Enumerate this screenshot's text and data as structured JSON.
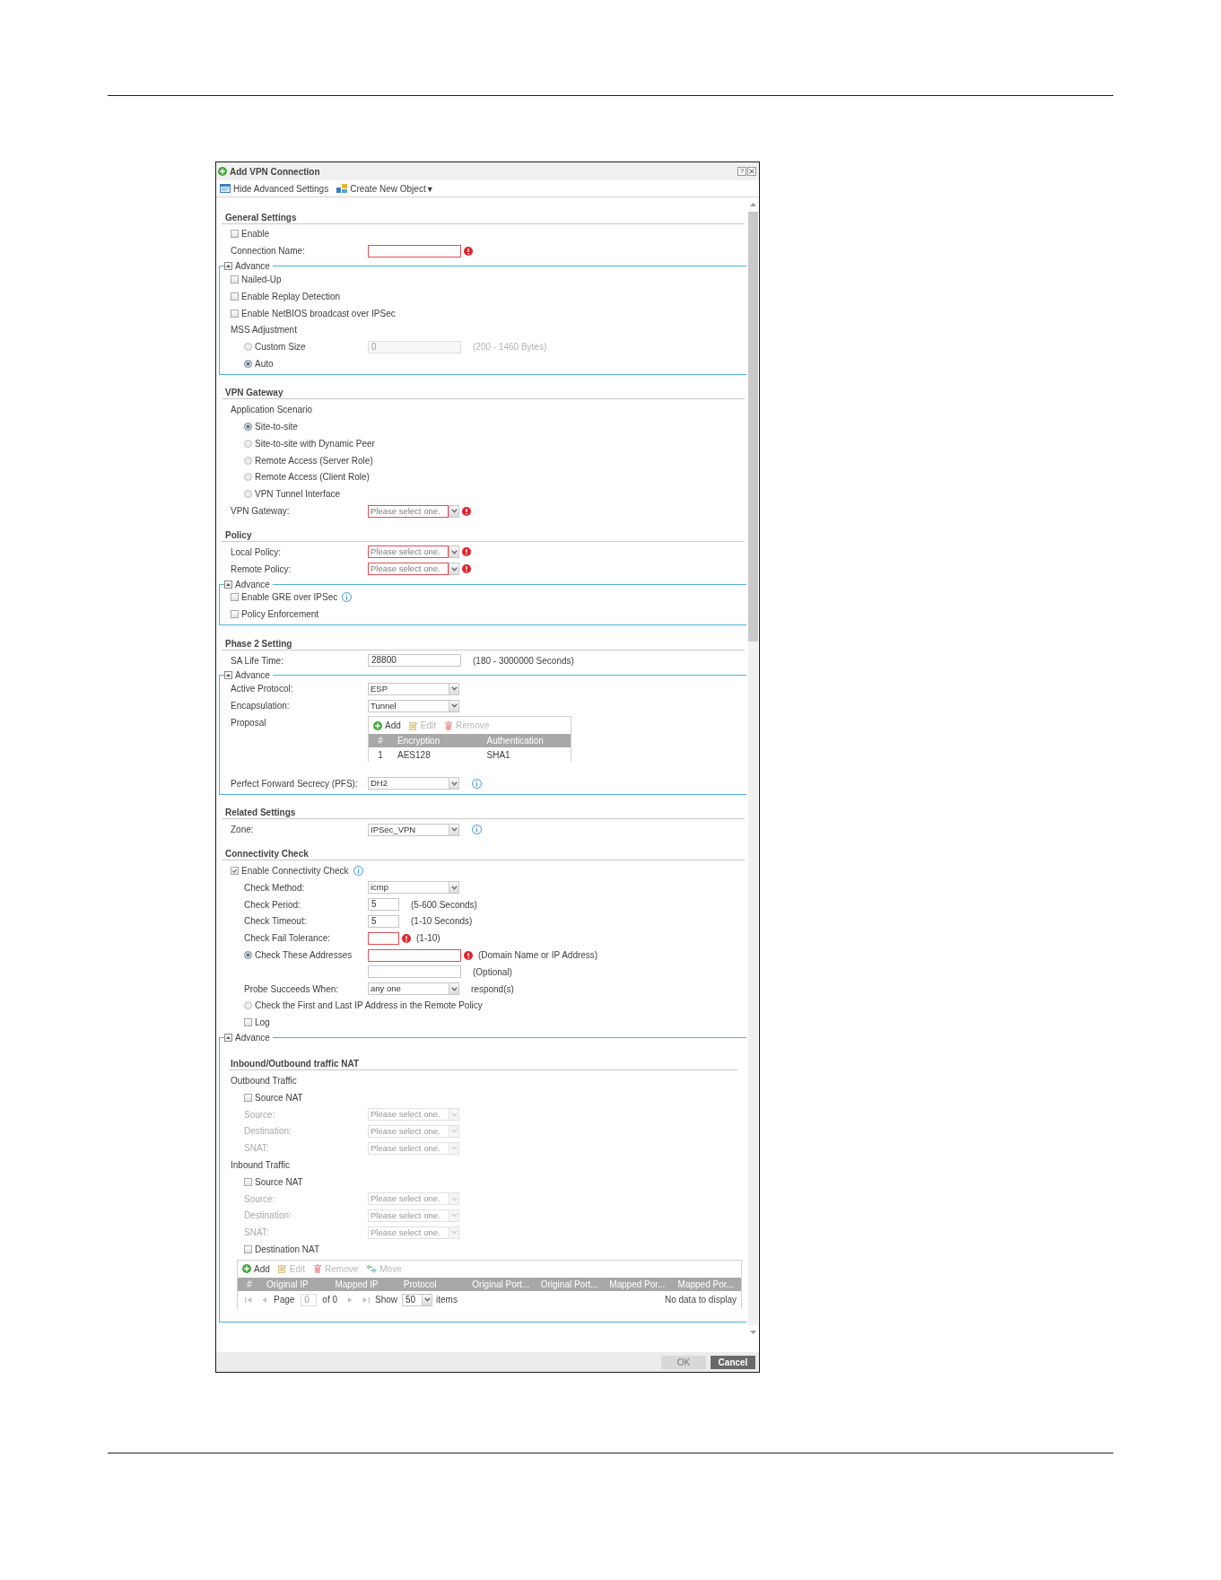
{
  "window": {
    "title": "Add VPN Connection",
    "controls": [
      {
        "kind": "help",
        "glyph": "?"
      },
      {
        "kind": "close"
      }
    ]
  },
  "toolbar": [
    {
      "kind": "toggle",
      "label": "Hide Advanced Settings"
    },
    {
      "kind": "menu",
      "label": "Create New Object",
      "caret": "▼"
    }
  ],
  "sections": [
    {
      "title": "General Settings",
      "rows": [
        {
          "kind": "checkbox",
          "label": "Enable",
          "checked": false
        },
        {
          "kind": "text",
          "label": "Connection Name:",
          "error": true,
          "disabled": false
        }
      ],
      "advance": {
        "label": "Advance",
        "expanded": true,
        "rows": [
          {
            "kind": "checkbox",
            "label": "Nailed-Up",
            "checked": false
          },
          {
            "kind": "checkbox",
            "label": "Enable Replay Detection",
            "checked": false
          },
          {
            "kind": "checkbox",
            "label": "Enable NetBIOS broadcast over IPSec",
            "checked": false
          },
          {
            "kind": "group",
            "label": "MSS Adjustment",
            "children": [
              {
                "kind": "radio",
                "label": "Custom Size",
                "selected": false,
                "input": {
                  "value": "0",
                  "error": false,
                  "disabled": true
                },
                "hint": "(200 - 1460 Bytes)"
              },
              {
                "kind": "radio",
                "label": "Auto",
                "selected": true
              }
            ]
          }
        ]
      }
    },
    {
      "title": "VPN Gateway",
      "rows": [
        {
          "kind": "group",
          "label": "Application Scenario",
          "children": [
            {
              "kind": "radio",
              "label": "Site-to-site",
              "selected": true
            },
            {
              "kind": "radio",
              "label": "Site-to-site with Dynamic Peer",
              "selected": false
            },
            {
              "kind": "radio",
              "label": "Remote Access (Server Role)",
              "selected": false
            },
            {
              "kind": "radio",
              "label": "Remote Access (Client Role)",
              "selected": false
            },
            {
              "kind": "radio",
              "label": "VPN Tunnel Interface",
              "selected": false
            }
          ]
        },
        {
          "kind": "select",
          "label": "VPN Gateway:",
          "placeholder": "Please select one.",
          "error": true,
          "disabled": false
        }
      ]
    },
    {
      "title": "Policy",
      "rows": [
        {
          "kind": "select",
          "label": "Local Policy:",
          "placeholder": "Please select one.",
          "error": true,
          "disabled": false
        },
        {
          "kind": "select",
          "label": "Remote Policy:",
          "placeholder": "Please select one.",
          "error": true,
          "disabled": false
        }
      ],
      "advance": {
        "label": "Advance",
        "expanded": true,
        "rows": [
          {
            "kind": "checkbox",
            "label": "Enable GRE over IPSec",
            "checked": false,
            "info": true
          },
          {
            "kind": "checkbox",
            "label": "Policy Enforcement",
            "checked": false
          }
        ]
      }
    },
    {
      "title": "Phase 2 Setting",
      "rows": [
        {
          "kind": "text",
          "label": "SA Life Time:",
          "value": "28800",
          "error": false,
          "disabled": false,
          "hint": "(180 - 3000000 Seconds)"
        }
      ],
      "advance": {
        "label": "Advance",
        "expanded": true,
        "rows": [
          {
            "kind": "select",
            "label": "Active Protocol:",
            "value": "ESP",
            "error": false,
            "disabled": false
          },
          {
            "kind": "select",
            "label": "Encapsulation:",
            "value": "Tunnel",
            "error": false,
            "disabled": false
          },
          {
            "kind": "table",
            "label": "Proposal",
            "actions": [
              {
                "kind": "add",
                "label": "Add",
                "disabled": false
              },
              {
                "kind": "edit",
                "label": "Edit",
                "disabled": true
              },
              {
                "kind": "remove",
                "label": "Remove",
                "disabled": true
              }
            ],
            "columns": [
              "#",
              "Encryption",
              "Authentication"
            ],
            "rows": [
              [
                "1",
                "AES128",
                "SHA1"
              ]
            ]
          },
          {
            "kind": "select",
            "label": "Perfect Forward Secrecy (PFS):",
            "value": "DH2",
            "error": false,
            "disabled": false,
            "info": true
          }
        ]
      }
    },
    {
      "title": "Related Settings",
      "rows": [
        {
          "kind": "select",
          "label": "Zone:",
          "value": "IPSec_VPN",
          "error": false,
          "disabled": false,
          "info": true
        }
      ]
    },
    {
      "title": "Connectivity Check",
      "rows": [
        {
          "kind": "checkbox",
          "label": "Enable Connectivity Check",
          "checked": true,
          "info": true,
          "children": [
            {
              "kind": "select",
              "label": "Check Method:",
              "value": "icmp",
              "error": false,
              "disabled": false
            },
            {
              "kind": "number",
              "label": "Check Period:",
              "value": "5",
              "error": false,
              "disabled": false,
              "hint": "(5-600 Seconds)"
            },
            {
              "kind": "number",
              "label": "Check Timeout:",
              "value": "5",
              "error": false,
              "disabled": false,
              "hint": "(1-10 Seconds)"
            },
            {
              "kind": "number",
              "label": "Check Fail Tolerance:",
              "error": true,
              "disabled": false,
              "hint": "(1-10)"
            },
            {
              "kind": "radio",
              "label": "Check These Addresses",
              "selected": true,
              "input": {
                "error": true,
                "disabled": false
              },
              "hint": "(Domain Name or IP Address)"
            },
            {
              "kind": "text",
              "error": false,
              "disabled": false,
              "hint": "(Optional)"
            },
            {
              "kind": "select",
              "label": "Probe Succeeds When:",
              "value": "any one",
              "error": false,
              "disabled": false,
              "hint": "respond(s)"
            },
            {
              "kind": "radio",
              "label": "Check the First and Last IP Address in the Remote Policy",
              "selected": false
            },
            {
              "kind": "checkbox",
              "label": "Log",
              "checked": false
            }
          ]
        }
      ],
      "advance": {
        "label": "Advance",
        "expanded": true,
        "rows": [
          {
            "kind": "subheader",
            "label": "Inbound/Outbound traffic NAT"
          },
          {
            "kind": "group",
            "label": "Outbound Traffic",
            "children": [
              {
                "kind": "checkbox",
                "label": "Source NAT",
                "checked": false
              },
              {
                "kind": "select",
                "label": "Source:",
                "placeholder": "Please select one.",
                "error": false,
                "disabled": true
              },
              {
                "kind": "select",
                "label": "Destination:",
                "placeholder": "Please select one.",
                "error": false,
                "disabled": true
              },
              {
                "kind": "select",
                "label": "SNAT:",
                "placeholder": "Please select one.",
                "error": false,
                "disabled": true
              }
            ]
          },
          {
            "kind": "group",
            "label": "Inbound Traffic",
            "children": [
              {
                "kind": "checkbox",
                "label": "Source NAT",
                "checked": false
              },
              {
                "kind": "select",
                "label": "Source:",
                "placeholder": "Please select one.",
                "error": false,
                "disabled": true
              },
              {
                "kind": "select",
                "label": "Destination:",
                "placeholder": "Please select one.",
                "error": false,
                "disabled": true
              },
              {
                "kind": "select",
                "label": "SNAT:",
                "placeholder": "Please select one.",
                "error": false,
                "disabled": true
              },
              {
                "kind": "checkbox",
                "label": "Destination NAT",
                "checked": false
              },
              {
                "kind": "table",
                "actions": [
                  {
                    "kind": "add",
                    "label": "Add",
                    "disabled": false
                  },
                  {
                    "kind": "edit",
                    "label": "Edit",
                    "disabled": true
                  },
                  {
                    "kind": "remove",
                    "label": "Remove",
                    "disabled": true
                  },
                  {
                    "kind": "move",
                    "label": "Move",
                    "disabled": true
                  }
                ],
                "columns": [
                  "#",
                  "Original IP",
                  "Mapped IP",
                  "Protocol",
                  "Original Port...",
                  "Original Port...",
                  "Mapped Por...",
                  "Mapped Por..."
                ],
                "pager": {
                  "page_label": "Page",
                  "page": "0",
                  "of": "of 0",
                  "show": "Show",
                  "per_page": "50",
                  "items": "items",
                  "status": "No data to display"
                }
              }
            ]
          }
        ]
      }
    }
  ],
  "buttons": [
    {
      "label": "OK",
      "disabled": true
    },
    {
      "label": "Cancel",
      "disabled": false
    }
  ]
}
